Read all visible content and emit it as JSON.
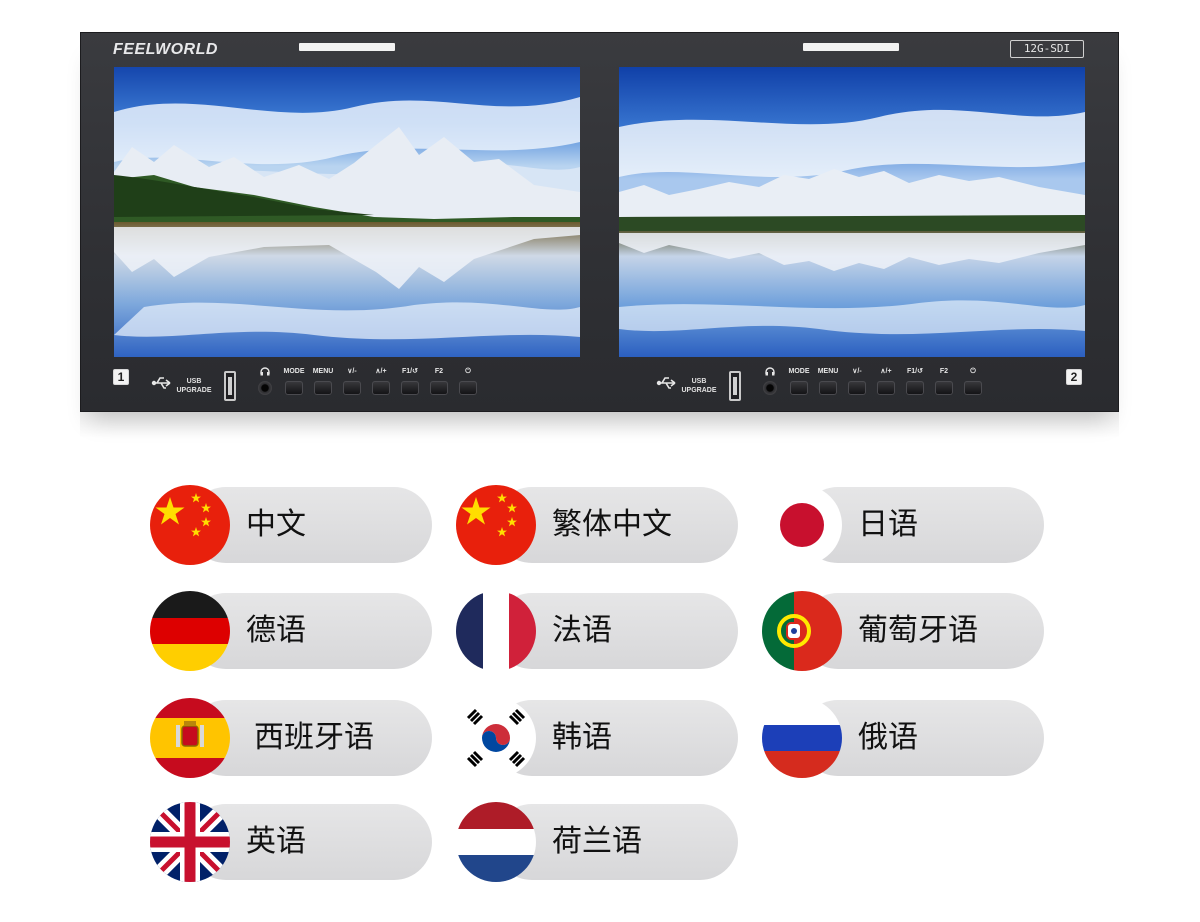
{
  "monitor": {
    "brand": "FEELWORLD",
    "signal_badge": "12G-SDI",
    "channels": [
      "1",
      "2"
    ],
    "usb": {
      "line1": "USB",
      "line2": "UPGRADE"
    },
    "buttons": [
      "MODE",
      "MENU",
      "∨/-",
      "∧/+",
      "F1/↺",
      "F2",
      "⏻"
    ],
    "headphone_symbol": "🎧"
  },
  "languages": [
    {
      "label": "中文",
      "flag": "china-flag-icon"
    },
    {
      "label": "繁体中文",
      "flag": "china-flag-icon"
    },
    {
      "label": "日语",
      "flag": "japan-flag-icon"
    },
    {
      "label": "德语",
      "flag": "germany-flag-icon"
    },
    {
      "label": "法语",
      "flag": "france-flag-icon"
    },
    {
      "label": "葡萄牙语",
      "flag": "portugal-flag-icon"
    },
    {
      "label": "西班牙语",
      "flag": "spain-flag-icon"
    },
    {
      "label": "韩语",
      "flag": "korea-flag-icon"
    },
    {
      "label": "俄语",
      "flag": "russia-flag-icon"
    },
    {
      "label": "英语",
      "flag": "uk-flag-icon"
    },
    {
      "label": "荷兰语",
      "flag": "netherlands-flag-icon"
    }
  ],
  "colors": {
    "bezel": "#2f3034",
    "pill": "#dedee0",
    "text": "#111111"
  }
}
